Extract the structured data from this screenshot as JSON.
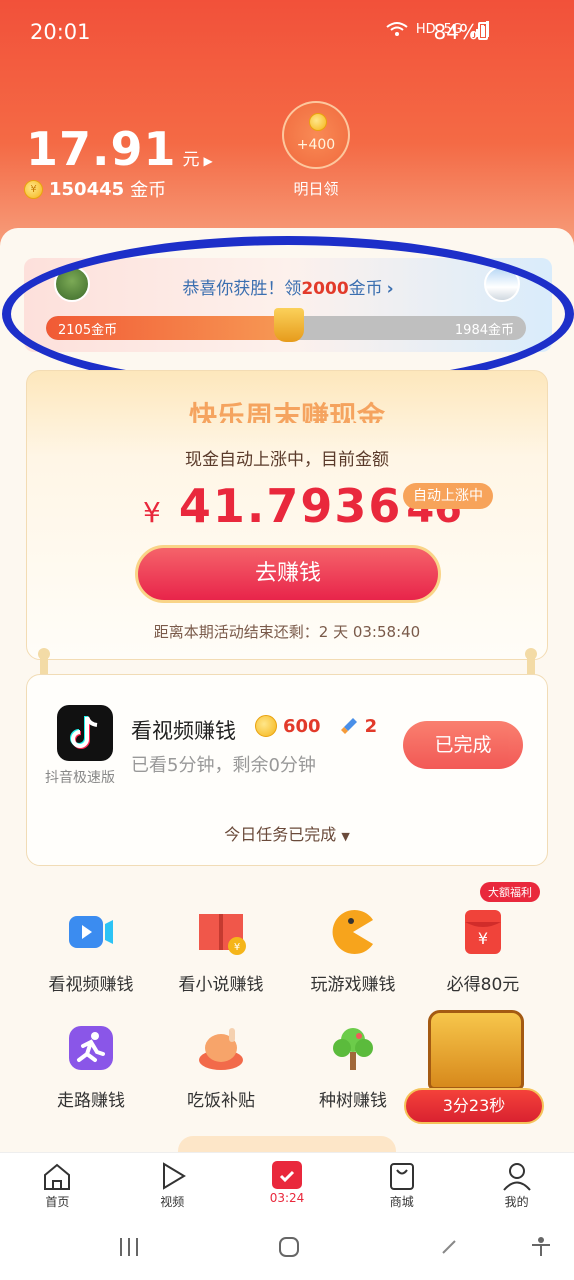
{
  "status_bar": {
    "time": "20:01",
    "network": "HD",
    "signal": "5G",
    "battery": "84%"
  },
  "header": {
    "balance": "17.91",
    "balance_unit": "元",
    "coins": "150445",
    "coins_unit": "金币",
    "bonus_amount": "+400",
    "bonus_label": "明日领"
  },
  "pk_banner": {
    "title_prefix": "恭喜你获胜！领",
    "title_highlight": "2000",
    "title_suffix": "金币",
    "left_score": "2105金币",
    "right_score": "1984金币",
    "left_share": 0.515
  },
  "cash_card": {
    "heading": "快乐周末赚现金",
    "subtitle": "现金自动上涨中，目前金额",
    "currency": "¥",
    "amount": "41.7936",
    "amount_tail": "46",
    "auto_badge": "自动上涨中",
    "button_label": "去赚钱",
    "countdown": "距离本期活动结束还剩：2 天 03:58:40"
  },
  "task": {
    "app_name": "抖音极速版",
    "title": "看视频赚钱",
    "reward_coins": "600",
    "reward_boost": "2",
    "description": "已看5分钟，剩余0分钟",
    "button_label": "已完成",
    "footer": "今日任务已完成"
  },
  "grid": [
    {
      "label": "看视频赚钱",
      "icon": "video-icon"
    },
    {
      "label": "看小说赚钱",
      "icon": "book-icon"
    },
    {
      "label": "玩游戏赚钱",
      "icon": "pacman-icon"
    },
    {
      "label": "必得80元",
      "icon": "red-envelope-icon",
      "badge": "大额福利"
    },
    {
      "label": "走路赚钱",
      "icon": "running-icon"
    },
    {
      "label": "吃饭补贴",
      "icon": "chicken-icon"
    },
    {
      "label": "种树赚钱",
      "icon": "tree-icon"
    }
  ],
  "treasure": {
    "timer": "3分23秒"
  },
  "bottom_nav": [
    {
      "label": "首页",
      "icon": "home-icon"
    },
    {
      "label": "视频",
      "icon": "play-icon"
    },
    {
      "label": "03:24",
      "icon": "calendar-check-icon",
      "active": true
    },
    {
      "label": "商城",
      "icon": "shopping-bag-icon"
    },
    {
      "label": "我的",
      "icon": "profile-icon"
    }
  ],
  "colors": {
    "accent": "#e9283c",
    "header": "#f2513a",
    "annotation": "#1d2fc9"
  }
}
